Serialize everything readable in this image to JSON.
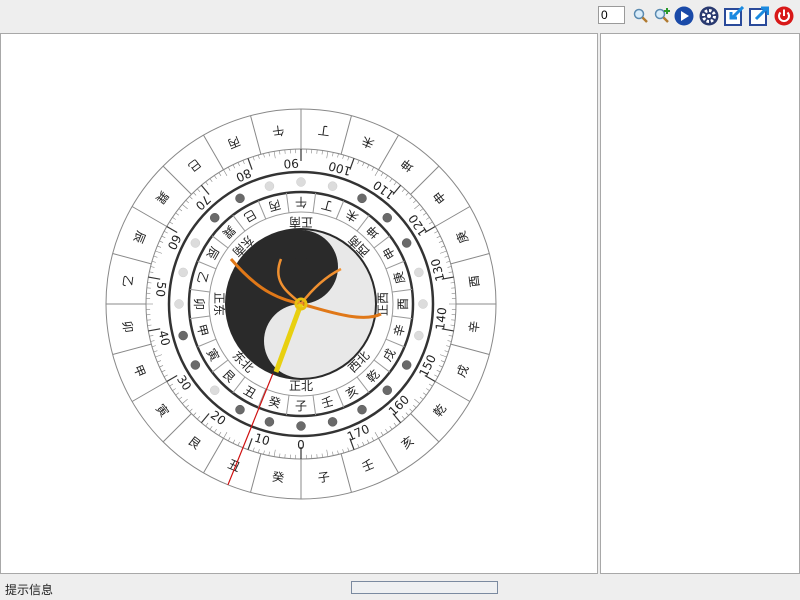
{
  "toolbar": {
    "angle_value": "0",
    "buttons": [
      {
        "name": "zoom-out-button",
        "icon": "magnifier-icon"
      },
      {
        "name": "zoom-in-button",
        "icon": "magnifier-plus-icon"
      },
      {
        "name": "play-button",
        "icon": "play-icon"
      },
      {
        "name": "settings-button",
        "icon": "gear-icon"
      },
      {
        "name": "import-button",
        "icon": "arrow-in-icon"
      },
      {
        "name": "export-button",
        "icon": "arrow-out-icon"
      },
      {
        "name": "power-button",
        "icon": "power-icon"
      }
    ]
  },
  "compass": {
    "outer_ring": [
      "癸",
      "丑",
      "艮",
      "寅",
      "甲",
      "卯",
      "乙",
      "辰",
      "巽",
      "巳",
      "丙",
      "午",
      "丁",
      "未",
      "坤",
      "申",
      "庚",
      "酉",
      "辛",
      "戌",
      "乾",
      "亥",
      "壬",
      "子"
    ],
    "inner_ring": [
      "子",
      "癸",
      "丑",
      "艮",
      "寅",
      "甲",
      "卯",
      "乙",
      "辰",
      "巽",
      "巳",
      "丙",
      "午",
      "丁",
      "未",
      "坤",
      "申",
      "庚",
      "酉",
      "辛",
      "戌",
      "乾",
      "亥",
      "壬"
    ],
    "directions": [
      "正北",
      "东北",
      "正东",
      "东南",
      "正南",
      "西南",
      "正西",
      "西北"
    ],
    "scale_labels": [
      "0",
      "10",
      "20",
      "30",
      "40",
      "50",
      "60",
      "70",
      "80",
      "90",
      "100",
      "110",
      "120",
      "130",
      "140",
      "150",
      "160",
      "170"
    ],
    "needle_reading": 11
  },
  "statusbar": {
    "hint": "提示信息",
    "progress": 0
  }
}
